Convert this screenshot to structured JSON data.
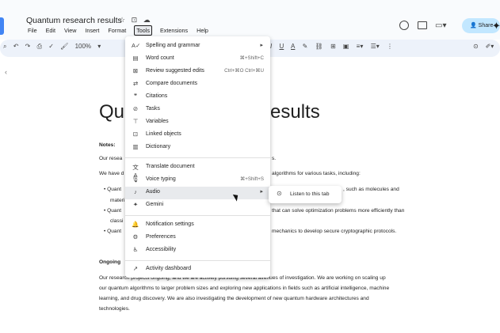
{
  "document": {
    "title": "Quantum research results",
    "heading_left": "Qu",
    "heading_right": "esults",
    "paragraphs": {
      "notes": "Notes:",
      "p1": "Our resea",
      "p1_tail": "s.",
      "p2": "We have d",
      "p2_tail": "algorithms for various tasks, including:",
      "b1": "Quant",
      "b1_tail": ", such as molecules and",
      "b1_cont": "materi",
      "b2": "Quant",
      "b2_tail": "that can solve optimization problems more efficiently than",
      "b2_cont": "classi",
      "b3": "Quant",
      "b3_tail": "mechanics to develop secure cryptographic protocols.",
      "ongoing": "Ongoing",
      "final_1": "Our research projects ongoing, and we are actively pursuing several avenues of investigation. We are working on scaling up",
      "final_2": "our quantum algorithms to larger problem sizes and exploring new applications in fields such as artificial intelligence, machine",
      "final_3": "learning, and drug discovery. We are also investigating the development of new quantum hardware architectures and",
      "final_4": "technologies."
    }
  },
  "menubar": [
    "File",
    "Edit",
    "View",
    "Insert",
    "Format",
    "Tools",
    "Extensions",
    "Help"
  ],
  "share_label": "Share",
  "toolbar": {
    "zoom": "100%"
  },
  "tools_menu": {
    "items": [
      {
        "label": "Spelling and grammar",
        "shortcut": "",
        "submenu": true
      },
      {
        "label": "Word count",
        "shortcut": "⌘+Shift+C"
      },
      {
        "label": "Review suggested edits",
        "shortcut": "Ctrl+⌘O Ctrl+⌘U"
      },
      {
        "label": "Compare documents",
        "shortcut": ""
      },
      {
        "label": "Citations",
        "shortcut": ""
      },
      {
        "label": "Tasks",
        "shortcut": ""
      },
      {
        "label": "Variables",
        "shortcut": ""
      },
      {
        "label": "Linked objects",
        "shortcut": ""
      },
      {
        "label": "Dictionary",
        "shortcut": ""
      },
      {
        "label": "Translate document",
        "shortcut": ""
      },
      {
        "label": "Voice typing",
        "shortcut": "⌘+Shift+S"
      },
      {
        "label": "Audio",
        "shortcut": "",
        "submenu": true
      },
      {
        "label": "Gemini",
        "shortcut": ""
      },
      {
        "label": "Notification settings",
        "shortcut": ""
      },
      {
        "label": "Preferences",
        "shortcut": ""
      },
      {
        "label": "Accessibility",
        "shortcut": ""
      },
      {
        "label": "Activity dashboard",
        "shortcut": ""
      }
    ]
  },
  "audio_submenu": {
    "label": "Listen to this tab"
  }
}
